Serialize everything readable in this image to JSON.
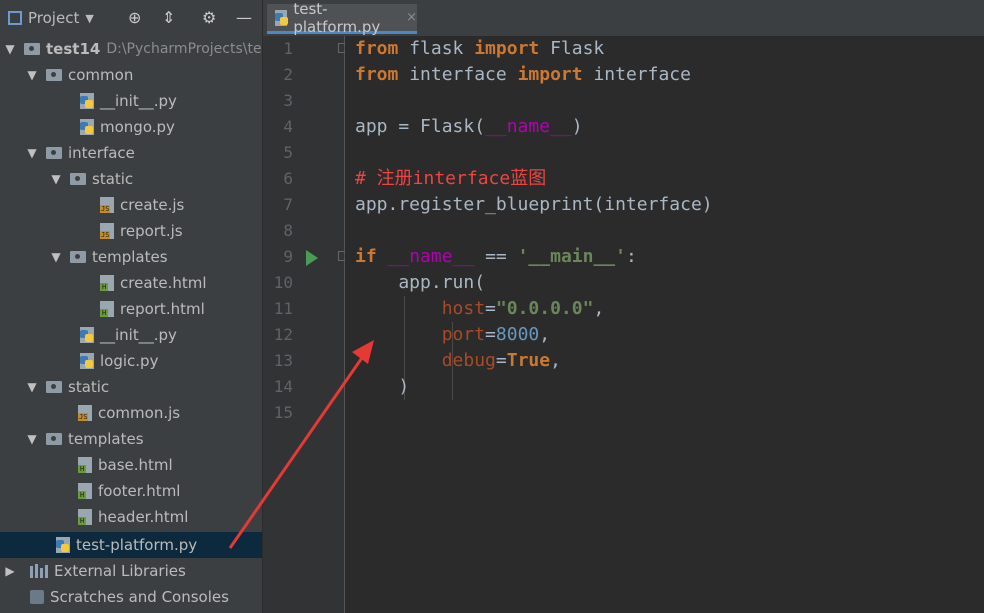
{
  "project": {
    "header_label": "Project",
    "icons": [
      "project-icon",
      "locate-icon",
      "collapse-icon",
      "gear-icon",
      "minimize-icon"
    ]
  },
  "tree": {
    "root": {
      "name": "test14",
      "path": "D:\\PycharmProjects\\te"
    },
    "items": [
      {
        "label": "common"
      },
      {
        "label": "__init__.py"
      },
      {
        "label": "mongo.py"
      },
      {
        "label": "interface"
      },
      {
        "label": "static"
      },
      {
        "label": "create.js"
      },
      {
        "label": "report.js"
      },
      {
        "label": "templates"
      },
      {
        "label": "create.html"
      },
      {
        "label": "report.html"
      },
      {
        "label": "__init__.py"
      },
      {
        "label": "logic.py"
      },
      {
        "label": "static"
      },
      {
        "label": "common.js"
      },
      {
        "label": "templates"
      },
      {
        "label": "base.html"
      },
      {
        "label": "footer.html"
      },
      {
        "label": "header.html"
      },
      {
        "label": "test-platform.py"
      },
      {
        "label": "External Libraries"
      },
      {
        "label": "Scratches and Consoles"
      }
    ]
  },
  "editor": {
    "tab_label": "test-platform.py",
    "tab_close": "×",
    "line_numbers": [
      "1",
      "2",
      "3",
      "4",
      "5",
      "6",
      "7",
      "8",
      "9",
      "10",
      "11",
      "12",
      "13",
      "14",
      "15"
    ],
    "lines": {
      "l1_kw1": "from",
      "l1_mod": " flask ",
      "l1_kw2": "import",
      "l1_name": " Flask",
      "l2_kw1": "from",
      "l2_mod": " interface ",
      "l2_kw2": "import",
      "l2_name": " interface",
      "l4_a": "app = Flask(",
      "l4_b": "__name__",
      "l4_c": ")",
      "l6": "# 注册interface蓝图",
      "l7": "app.register_blueprint(interface)",
      "l9_kw": "if",
      "l9_a": " ",
      "l9_b": "__name__",
      "l9_c": " == ",
      "l9_d": "'__main__'",
      "l9_e": ":",
      "l10": "    app.run(",
      "l11_p": "        host",
      "l11_eq": "=",
      "l11_s": "\"0.0.0.0\"",
      "l11_c": ",",
      "l12_p": "        port",
      "l12_eq": "=",
      "l12_n": "8000",
      "l12_c": ",",
      "l13_p": "        debug",
      "l13_eq": "=",
      "l13_k": "True",
      "l13_c": ",",
      "l14": "    )"
    }
  },
  "colors": {
    "annotation_arrow": "#e53935"
  }
}
